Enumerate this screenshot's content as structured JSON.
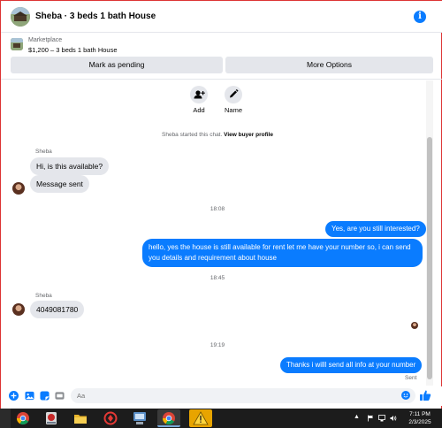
{
  "header": {
    "title": "Sheba · 3 beds 1 bath House",
    "info_icon": "info-icon"
  },
  "listing": {
    "source": "Marketplace",
    "detail": "$1,200 – 3 beds 1 bath House",
    "mark_pending_label": "Mark as pending",
    "more_options_label": "More Options"
  },
  "actions": {
    "add_label": "Add",
    "name_label": "Name"
  },
  "system": {
    "started_text": "Sheba started this chat.",
    "view_profile_link": "View buyer profile"
  },
  "messages": {
    "sender_1": "Sheba",
    "msg_1": "Hi, is this available?",
    "msg_2": "Message sent",
    "time_1": "18:08",
    "msg_3": "Yes, are you still interested?",
    "msg_4_line1": "hello, yes the house is still available for rent  let me have your number so, i can send",
    "msg_4_line2": "you details and requirement about house",
    "time_2": "18:45",
    "sender_2": "Sheba",
    "msg_5": "4049081780",
    "time_3": "19:19",
    "msg_6": "Thanks i willl send all info at your number",
    "status": "Sent"
  },
  "composer": {
    "placeholder": "Aa"
  },
  "taskbar": {
    "time": "7:11 PM",
    "date": "2/3/2025"
  },
  "colors": {
    "accent": "#0a7cff",
    "bubble_in": "#e4e6eb",
    "muted_text": "#65676b"
  }
}
